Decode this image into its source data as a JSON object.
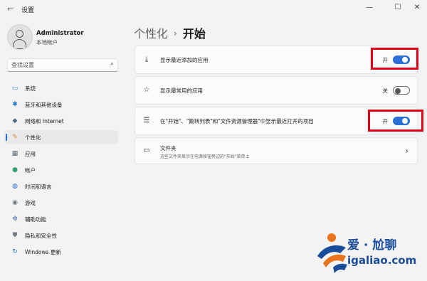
{
  "window": {
    "title": "设置"
  },
  "user": {
    "name": "Administrator",
    "subtitle": "本地帐户"
  },
  "search": {
    "placeholder": "查找设置"
  },
  "sidebar": {
    "items": [
      {
        "label": "系统",
        "icon": "monitor-icon",
        "color": "#2b8ad8"
      },
      {
        "label": "蓝牙和其他设备",
        "icon": "bluetooth-icon",
        "color": "#1e73c7"
      },
      {
        "label": "网络和 Internet",
        "icon": "wifi-icon",
        "color": "#4a6785"
      },
      {
        "label": "个性化",
        "icon": "brush-icon",
        "color": "#d28b2e",
        "active": true
      },
      {
        "label": "应用",
        "icon": "apps-icon",
        "color": "#5a6878"
      },
      {
        "label": "帐户",
        "icon": "person-icon",
        "color": "#2fa36b"
      },
      {
        "label": "时间和语言",
        "icon": "globe-icon",
        "color": "#1e73c7"
      },
      {
        "label": "游戏",
        "icon": "gamepad-icon",
        "color": "#6b7684"
      },
      {
        "label": "辅助功能",
        "icon": "accessibility-icon",
        "color": "#3a6fb5"
      },
      {
        "label": "隐私和安全性",
        "icon": "shield-icon",
        "color": "#6e7a86"
      },
      {
        "label": "Windows 更新",
        "icon": "update-icon",
        "color": "#1e73c7"
      }
    ]
  },
  "breadcrumb": {
    "parent": "个性化",
    "separator": "›",
    "current": "开始"
  },
  "settings": [
    {
      "label": "显示最近添加的应用",
      "state": "开",
      "on": true,
      "icon": "download-icon"
    },
    {
      "label": "显示最常用的应用",
      "state": "关",
      "on": false,
      "icon": "star-icon"
    },
    {
      "label": "在\"开始\"、\"跳转列表\"和\"文件资源管理器\"中显示最近打开的项目",
      "state": "开",
      "on": true,
      "icon": "list-icon"
    },
    {
      "label": "文件夹",
      "subtitle": "这些文件夹显示在电源按钮旁边的\"开始\"菜单上",
      "icon": "folder-icon"
    }
  ],
  "watermark": {
    "brand": "爱 · 尬聊",
    "url": "igaliao.com"
  },
  "colors": {
    "accent": "#2a6fd6",
    "highlight": "#e00019"
  }
}
